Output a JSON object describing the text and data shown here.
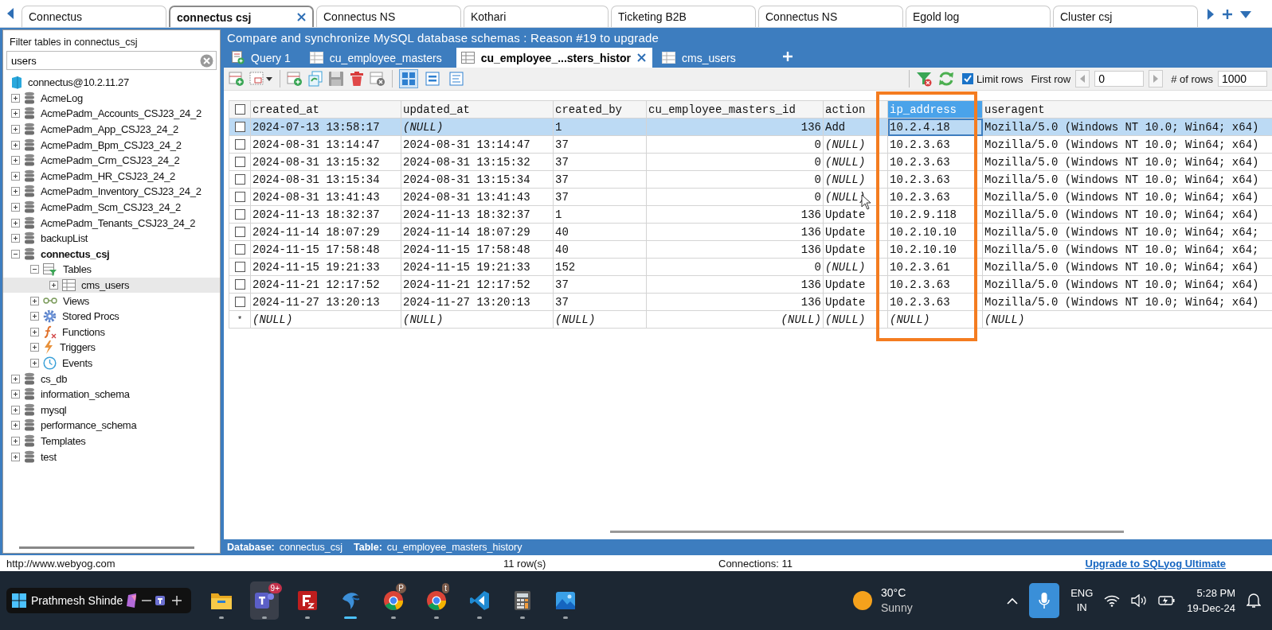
{
  "connection_tabs": [
    {
      "label": "Connectus",
      "selected": false
    },
    {
      "label": "connectus csj",
      "selected": true
    },
    {
      "label": "Connectus NS",
      "selected": false
    },
    {
      "label": "Kothari",
      "selected": false
    },
    {
      "label": "Ticketing B2B",
      "selected": false
    },
    {
      "label": "Connectus NS",
      "selected": false
    },
    {
      "label": "Egold log",
      "selected": false
    },
    {
      "label": "Cluster csj",
      "selected": false
    }
  ],
  "left_panel": {
    "filter_label": "Filter tables in connectus_csj",
    "filter_value": "users",
    "tree": {
      "label": "connectus@10.2.11.27",
      "kind": "server",
      "children": [
        {
          "label": "AcmeLog",
          "kind": "database",
          "expanded": false,
          "current": false,
          "selected": false
        },
        {
          "label": "AcmePadm_Accounts_CSJ23_24_2",
          "kind": "database",
          "expanded": false,
          "current": false,
          "selected": false
        },
        {
          "label": "AcmePadm_App_CSJ23_24_2",
          "kind": "database",
          "expanded": false,
          "current": false,
          "selected": false
        },
        {
          "label": "AcmePadm_Bpm_CSJ23_24_2",
          "kind": "database",
          "expanded": false,
          "current": false,
          "selected": false
        },
        {
          "label": "AcmePadm_Crm_CSJ23_24_2",
          "kind": "database",
          "expanded": false,
          "current": false,
          "selected": false
        },
        {
          "label": "AcmePadm_HR_CSJ23_24_2",
          "kind": "database",
          "expanded": false,
          "current": false,
          "selected": false
        },
        {
          "label": "AcmePadm_Inventory_CSJ23_24_2",
          "kind": "database",
          "expanded": false,
          "current": false,
          "selected": false
        },
        {
          "label": "AcmePadm_Scm_CSJ23_24_2",
          "kind": "database",
          "expanded": false,
          "current": false,
          "selected": false
        },
        {
          "label": "AcmePadm_Tenants_CSJ23_24_2",
          "kind": "database",
          "expanded": false,
          "current": false,
          "selected": false
        },
        {
          "label": "backupList",
          "kind": "database",
          "expanded": false,
          "current": false,
          "selected": false
        },
        {
          "label": "connectus_csj",
          "kind": "database",
          "expanded": true,
          "current": true,
          "selected": false,
          "children": [
            {
              "label": "Tables",
              "kind": "tables",
              "expanded": true,
              "selected": false,
              "children": [
                {
                  "label": "cms_users",
                  "kind": "table",
                  "expanded": false,
                  "selected": true
                }
              ]
            },
            {
              "label": "Views",
              "kind": "views",
              "expanded": false,
              "selected": false
            },
            {
              "label": "Stored Procs",
              "kind": "procs",
              "expanded": false,
              "selected": false
            },
            {
              "label": "Functions",
              "kind": "functions",
              "expanded": false,
              "selected": false
            },
            {
              "label": "Triggers",
              "kind": "triggers",
              "expanded": false,
              "selected": false
            },
            {
              "label": "Events",
              "kind": "events",
              "expanded": false,
              "selected": false
            }
          ]
        },
        {
          "label": "cs_db",
          "kind": "database",
          "expanded": false,
          "current": false,
          "selected": false
        },
        {
          "label": "information_schema",
          "kind": "database",
          "expanded": false,
          "current": false,
          "selected": false
        },
        {
          "label": "mysql",
          "kind": "database",
          "expanded": false,
          "current": false,
          "selected": false
        },
        {
          "label": "performance_schema",
          "kind": "database",
          "expanded": false,
          "current": false,
          "selected": false
        },
        {
          "label": "Templates",
          "kind": "database",
          "expanded": false,
          "current": false,
          "selected": false
        },
        {
          "label": "test",
          "kind": "database",
          "expanded": false,
          "current": false,
          "selected": false
        }
      ]
    }
  },
  "banner": "Compare and synchronize MySQL database schemas : Reason #19 to upgrade",
  "query_tabs": [
    {
      "label": "Query 1",
      "kind": "query",
      "selected": false,
      "closable": false
    },
    {
      "label": "cu_employee_masters",
      "kind": "table",
      "selected": false,
      "closable": false
    },
    {
      "label": "cu_employee_...sters_histor",
      "kind": "table",
      "selected": true,
      "closable": true
    },
    {
      "label": "cms_users",
      "kind": "table",
      "selected": false,
      "closable": false
    }
  ],
  "toolbar": {
    "views": [
      {
        "kind": "grid",
        "selected": true
      },
      {
        "kind": "form",
        "selected": false
      },
      {
        "kind": "text",
        "selected": false
      }
    ],
    "limit_rows": {
      "label": "Limit rows",
      "checked": true
    },
    "first_row_label": "First row",
    "first_row_value": "0",
    "rows_label": "# of rows",
    "rows_value": "1000"
  },
  "table": {
    "all_checked": false,
    "columns": [
      {
        "label": "created_at",
        "selected": false,
        "numeric": false,
        "highlighted": false
      },
      {
        "label": "updated_at",
        "selected": false,
        "numeric": false,
        "highlighted": false
      },
      {
        "label": "created_by",
        "selected": false,
        "numeric": false,
        "highlighted": false
      },
      {
        "label": "cu_employee_masters_id",
        "selected": false,
        "numeric": true,
        "highlighted": false
      },
      {
        "label": "action",
        "selected": false,
        "numeric": false,
        "highlighted": false
      },
      {
        "label": "ip_address",
        "selected": true,
        "numeric": false,
        "highlighted": true
      },
      {
        "label": "useragent",
        "selected": false,
        "numeric": false,
        "highlighted": false
      }
    ],
    "rows": [
      {
        "checked": false,
        "selected": true,
        "cells": [
          "2024-07-13 13:58:17",
          {
            "value": "(NULL)",
            "null": true
          },
          "1",
          "136",
          "Add",
          "10.2.4.18",
          "Mozilla/5.0 (Windows NT 10.0; Win64; x64)"
        ]
      },
      {
        "checked": false,
        "selected": false,
        "cells": [
          "2024-08-31 13:14:47",
          "2024-08-31 13:14:47",
          "37",
          "0",
          {
            "value": "(NULL)",
            "null": true
          },
          "10.2.3.63",
          "Mozilla/5.0 (Windows NT 10.0; Win64; x64)"
        ]
      },
      {
        "checked": false,
        "selected": false,
        "cells": [
          "2024-08-31 13:15:32",
          "2024-08-31 13:15:32",
          "37",
          "0",
          {
            "value": "(NULL)",
            "null": true
          },
          "10.2.3.63",
          "Mozilla/5.0 (Windows NT 10.0; Win64; x64)"
        ]
      },
      {
        "checked": false,
        "selected": false,
        "cells": [
          "2024-08-31 13:15:34",
          "2024-08-31 13:15:34",
          "37",
          "0",
          {
            "value": "(NULL)",
            "null": true
          },
          "10.2.3.63",
          "Mozilla/5.0 (Windows NT 10.0; Win64; x64)"
        ]
      },
      {
        "checked": false,
        "selected": false,
        "cells": [
          "2024-08-31 13:41:43",
          "2024-08-31 13:41:43",
          "37",
          "0",
          {
            "value": "(NULL)",
            "null": true
          },
          "10.2.3.63",
          "Mozilla/5.0 (Windows NT 10.0; Win64; x64)"
        ]
      },
      {
        "checked": false,
        "selected": false,
        "cells": [
          "2024-11-13 18:32:37",
          "2024-11-13 18:32:37",
          "1",
          "136",
          "Update",
          "10.2.9.118",
          "Mozilla/5.0 (Windows NT 10.0; Win64; x64)"
        ]
      },
      {
        "checked": false,
        "selected": false,
        "cells": [
          "2024-11-14 18:07:29",
          "2024-11-14 18:07:29",
          "40",
          "136",
          "Update",
          "10.2.10.10",
          "Mozilla/5.0 (Windows NT 10.0; Win64; x64;"
        ]
      },
      {
        "checked": false,
        "selected": false,
        "cells": [
          "2024-11-15 17:58:48",
          "2024-11-15 17:58:48",
          "40",
          "136",
          "Update",
          "10.2.10.10",
          "Mozilla/5.0 (Windows NT 10.0; Win64; x64;"
        ]
      },
      {
        "checked": false,
        "selected": false,
        "cells": [
          "2024-11-15 19:21:33",
          "2024-11-15 19:21:33",
          "152",
          "0",
          {
            "value": "(NULL)",
            "null": true
          },
          "10.2.3.61",
          "Mozilla/5.0 (Windows NT 10.0; Win64; x64)"
        ]
      },
      {
        "checked": false,
        "selected": false,
        "cells": [
          "2024-11-21 12:17:52",
          "2024-11-21 12:17:52",
          "37",
          "136",
          "Update",
          "10.2.3.63",
          "Mozilla/5.0 (Windows NT 10.0; Win64; x64)"
        ]
      },
      {
        "checked": false,
        "selected": false,
        "cells": [
          "2024-11-27 13:20:13",
          "2024-11-27 13:20:13",
          "37",
          "136",
          "Update",
          "10.2.3.63",
          "Mozilla/5.0 (Windows NT 10.0; Win64; x64)"
        ]
      }
    ],
    "new_row": {
      "marker": "*",
      "cells": [
        "(NULL)",
        "(NULL)",
        "(NULL)",
        "(NULL)",
        "(NULL)",
        "(NULL)",
        "(NULL)"
      ]
    }
  },
  "info_bar": {
    "database_label": "Database:",
    "database": "connectus_csj",
    "table_label": "Table:",
    "table": "cu_employee_masters_history"
  },
  "status_bar": {
    "url": "http://www.webyog.com",
    "rows": "11 row(s)",
    "connections": "Connections: 11",
    "upgrade_link": "Upgrade to SQLyog Ultimate"
  },
  "taskbar": {
    "caption": "Prathmesh Shinde",
    "apps": [
      {
        "kind": "folder",
        "active": false
      },
      {
        "kind": "chat",
        "active": false,
        "badge": "9+"
      },
      {
        "kind": "ftp",
        "active": false
      },
      {
        "kind": "dolphin",
        "active": true
      },
      {
        "kind": "browser",
        "active": false,
        "badge": "P"
      },
      {
        "kind": "browser",
        "active": false,
        "badge": "t"
      },
      {
        "kind": "code",
        "active": false
      },
      {
        "kind": "calculator",
        "active": false
      },
      {
        "kind": "photos",
        "active": false
      }
    ],
    "temperature": "30°C",
    "condition": "Sunny",
    "language": "ENG",
    "region": "IN",
    "time": "5:28 PM",
    "date": "19-Dec-24"
  }
}
